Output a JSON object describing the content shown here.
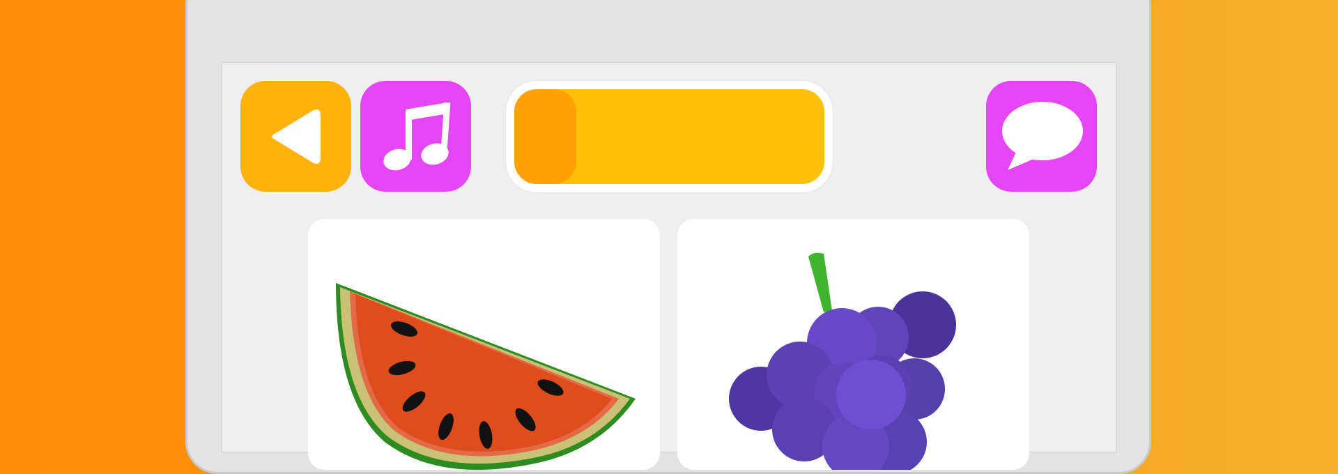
{
  "toolbar": {
    "back_button": {
      "icon": "back-triangle-icon",
      "color": "#ffb20a"
    },
    "music_button": {
      "icon": "music-note-icon",
      "color": "#e546f5"
    },
    "speech_button": {
      "icon": "speech-bubble-icon",
      "color": "#e546f5"
    }
  },
  "progress": {
    "fraction": 0.2,
    "track_color": "#ffc107",
    "fill_color": "#ffa103"
  },
  "choices": [
    {
      "item": "watermelon",
      "icon": "watermelon-icon"
    },
    {
      "item": "grapes",
      "icon": "grapes-icon"
    }
  ]
}
